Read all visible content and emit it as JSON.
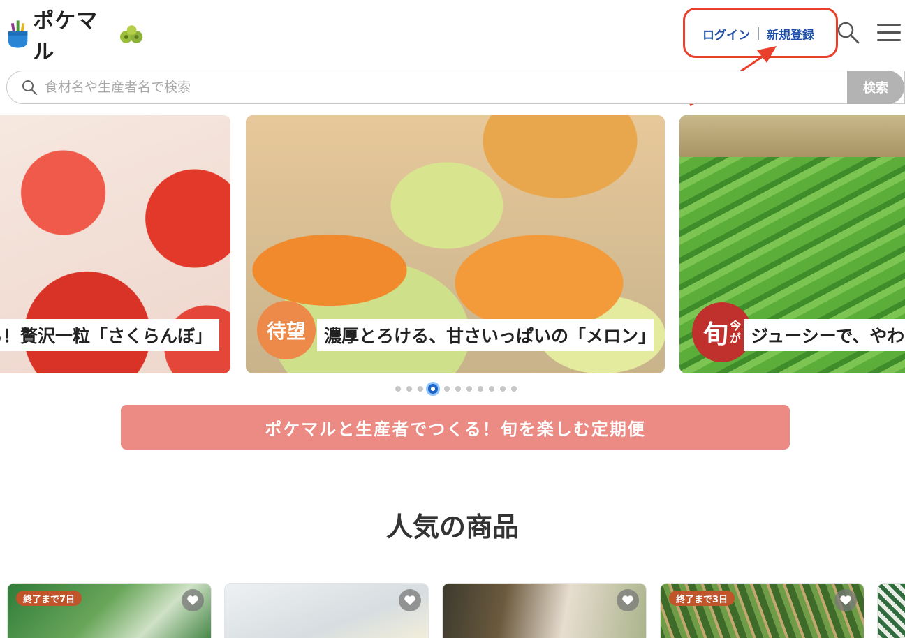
{
  "header": {
    "logo_text": "ポケマル",
    "login_label": "ログイン",
    "register_label": "新規登録"
  },
  "search": {
    "placeholder": "食材名や生産者名で検索",
    "button_label": "検索"
  },
  "carousel": {
    "slides": [
      {
        "caption": "る！贅沢一粒「さくらんぼ」"
      },
      {
        "badge": "待望",
        "caption": "濃厚とろける、甘さいっぱいの「メロン」"
      },
      {
        "badge": "旬",
        "badge_sub": "今が",
        "caption": "ジューシーで、やわら"
      }
    ],
    "dot_count": 11,
    "active_index": 3
  },
  "subscription_banner": "ポケマルと生産者でつくる！旬を楽しむ定期便",
  "popular_section_title": "人気の商品",
  "products": [
    {
      "deadline": "終了まで7日"
    },
    {
      "deadline": ""
    },
    {
      "deadline": ""
    },
    {
      "deadline": "終了まで3日"
    },
    {
      "deadline": ""
    }
  ],
  "colors": {
    "link": "#1f4fa8",
    "annotation": "#e8402a",
    "banner": "#ec8a84",
    "deadline_badge": "#c0542a"
  }
}
